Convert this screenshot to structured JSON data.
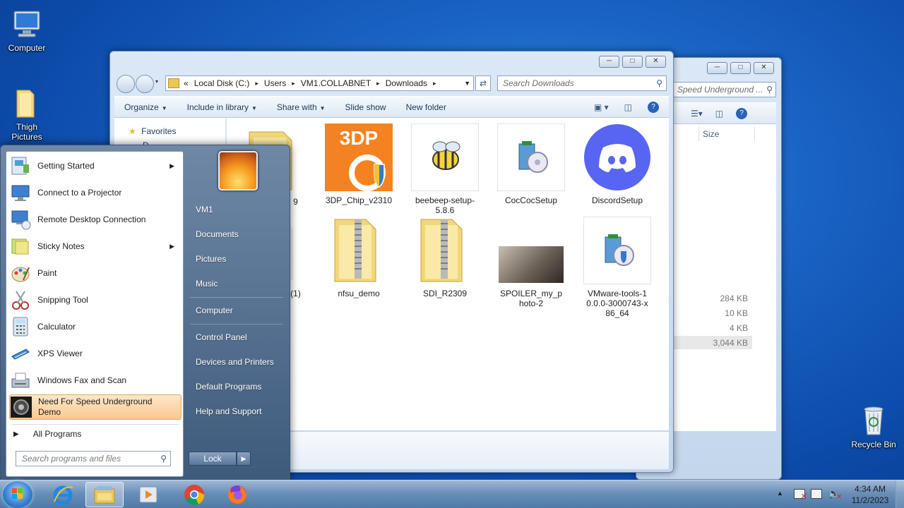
{
  "desktop": {
    "icons": [
      {
        "label": "Computer"
      },
      {
        "label": "Thigh Pictures"
      },
      {
        "label": "Recycle Bin"
      }
    ]
  },
  "back_window": {
    "search_placeholder": "Speed Underground ...",
    "column_size": "Size",
    "sizes": [
      "284 KB",
      "10 KB",
      "4 KB",
      "3,044 KB"
    ]
  },
  "explorer": {
    "breadcrumb": {
      "prefix": "«",
      "parts": [
        "Local Disk (C:)",
        "Users",
        "VM1.COLLABNET",
        "Downloads"
      ]
    },
    "search_placeholder": "Search Downloads",
    "toolbar": {
      "organize": "Organize",
      "include_in_library": "Include in library",
      "share_with": "Share with",
      "slide_show": "Slide show",
      "new_folder": "New folder"
    },
    "nav": {
      "favorites": "Favorites",
      "desktop_partial": "D..."
    },
    "files": [
      {
        "name": "9"
      },
      {
        "name": "3DP_Chip_v2310"
      },
      {
        "name": "beebeep-setup-5.8.6"
      },
      {
        "name": "CocCocSetup"
      },
      {
        "name": "DiscordSetup"
      },
      {
        "name": "(1)"
      },
      {
        "name": "nfsu_demo"
      },
      {
        "name": "SDI_R2309"
      },
      {
        "name": "SPOILER_my_photo-2"
      },
      {
        "name": "VMware-tools-10.0.0-3000743-x86_64"
      }
    ],
    "thumb_3dp": "3DP"
  },
  "start_menu": {
    "programs": [
      {
        "label": "Getting Started"
      },
      {
        "label": "Connect to a Projector"
      },
      {
        "label": "Remote Desktop Connection"
      },
      {
        "label": "Sticky Notes"
      },
      {
        "label": "Paint"
      },
      {
        "label": "Snipping Tool"
      },
      {
        "label": "Calculator"
      },
      {
        "label": "XPS Viewer"
      },
      {
        "label": "Windows Fax and Scan"
      },
      {
        "label": "Need For Speed Underground Demo"
      }
    ],
    "all_programs": "All Programs",
    "search_placeholder": "Search programs and files",
    "right": [
      "VM1",
      "Documents",
      "Pictures",
      "Music",
      "Computer",
      "Control Panel",
      "Devices and Printers",
      "Default Programs",
      "Help and Support"
    ],
    "lock": "Lock"
  },
  "taskbar": {
    "time": "4:34 AM",
    "date": "11/2/2023"
  }
}
